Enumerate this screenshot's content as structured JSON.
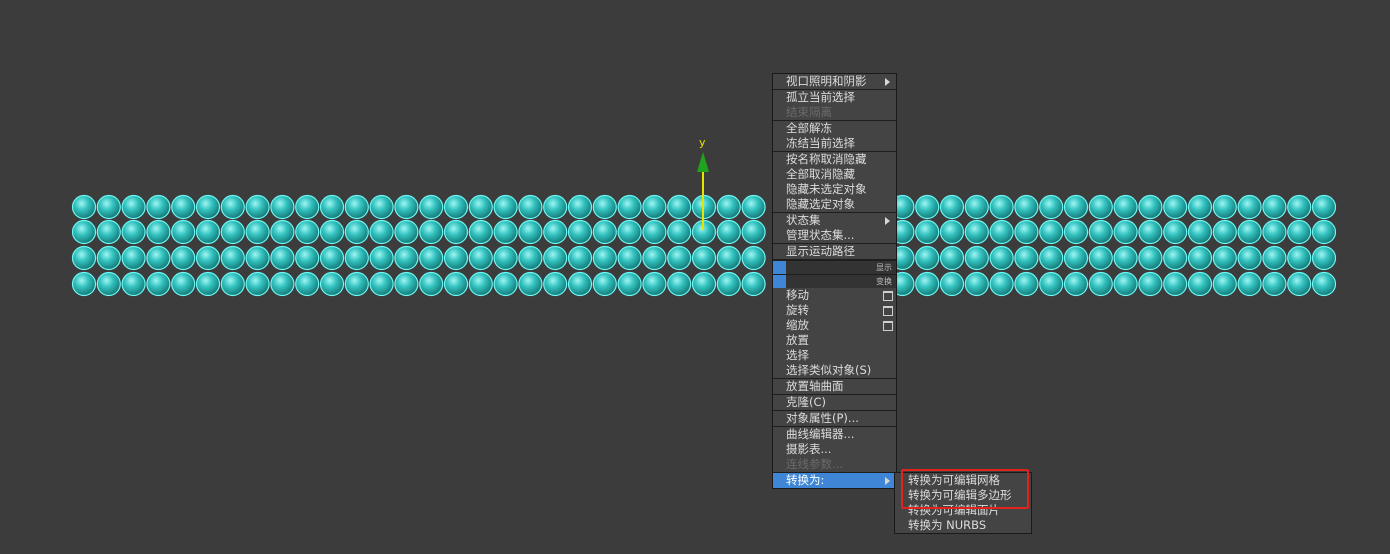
{
  "viewport": {
    "gizmo_axis_label": "y",
    "object_color": "#38c7c4"
  },
  "quad_menu": {
    "groups": [
      {
        "items": [
          {
            "label": "视口照明和阴影",
            "submenu": true
          }
        ]
      },
      {
        "items": [
          {
            "label": "孤立当前选择"
          },
          {
            "label": "结束隔离",
            "disabled": true
          }
        ]
      },
      {
        "items": [
          {
            "label": "全部解冻"
          },
          {
            "label": "冻结当前选择"
          }
        ]
      },
      {
        "items": [
          {
            "label": "按名称取消隐藏"
          },
          {
            "label": "全部取消隐藏"
          },
          {
            "label": "隐藏未选定对象"
          },
          {
            "label": "隐藏选定对象"
          }
        ]
      },
      {
        "items": [
          {
            "label": "状态集",
            "submenu": true
          },
          {
            "label": "管理状态集..."
          }
        ]
      },
      {
        "items": [
          {
            "label": "显示运动路径"
          }
        ]
      }
    ],
    "headers": [
      {
        "label": "显示"
      },
      {
        "label": "变换"
      }
    ],
    "transform_groups": [
      {
        "items": [
          {
            "label": "移动",
            "options": true
          },
          {
            "label": "旋转",
            "options": true
          },
          {
            "label": "缩放",
            "options": true
          },
          {
            "label": "放置"
          },
          {
            "label": "选择"
          },
          {
            "label": "选择类似对象(S)"
          }
        ]
      },
      {
        "items": [
          {
            "label": "放置轴曲面"
          }
        ]
      },
      {
        "items": [
          {
            "label": "克隆(C)"
          }
        ]
      },
      {
        "items": [
          {
            "label": "对象属性(P)..."
          }
        ]
      },
      {
        "items": [
          {
            "label": "曲线编辑器..."
          },
          {
            "label": "摄影表..."
          },
          {
            "label": "连线参数...",
            "disabled": true
          }
        ]
      },
      {
        "items": [
          {
            "label": "转换为:",
            "submenu": true,
            "active": true
          }
        ]
      }
    ]
  },
  "convert_submenu": {
    "items": [
      {
        "label": "转换为可编辑网格"
      },
      {
        "label": "转换为可编辑多边形"
      },
      {
        "label": "转换为可编辑面片"
      },
      {
        "label": "转换为 NURBS"
      }
    ]
  },
  "colors": {
    "accent": "#3f86d6",
    "highlight_box": "#e0241b",
    "background": "#3c3c3c"
  }
}
